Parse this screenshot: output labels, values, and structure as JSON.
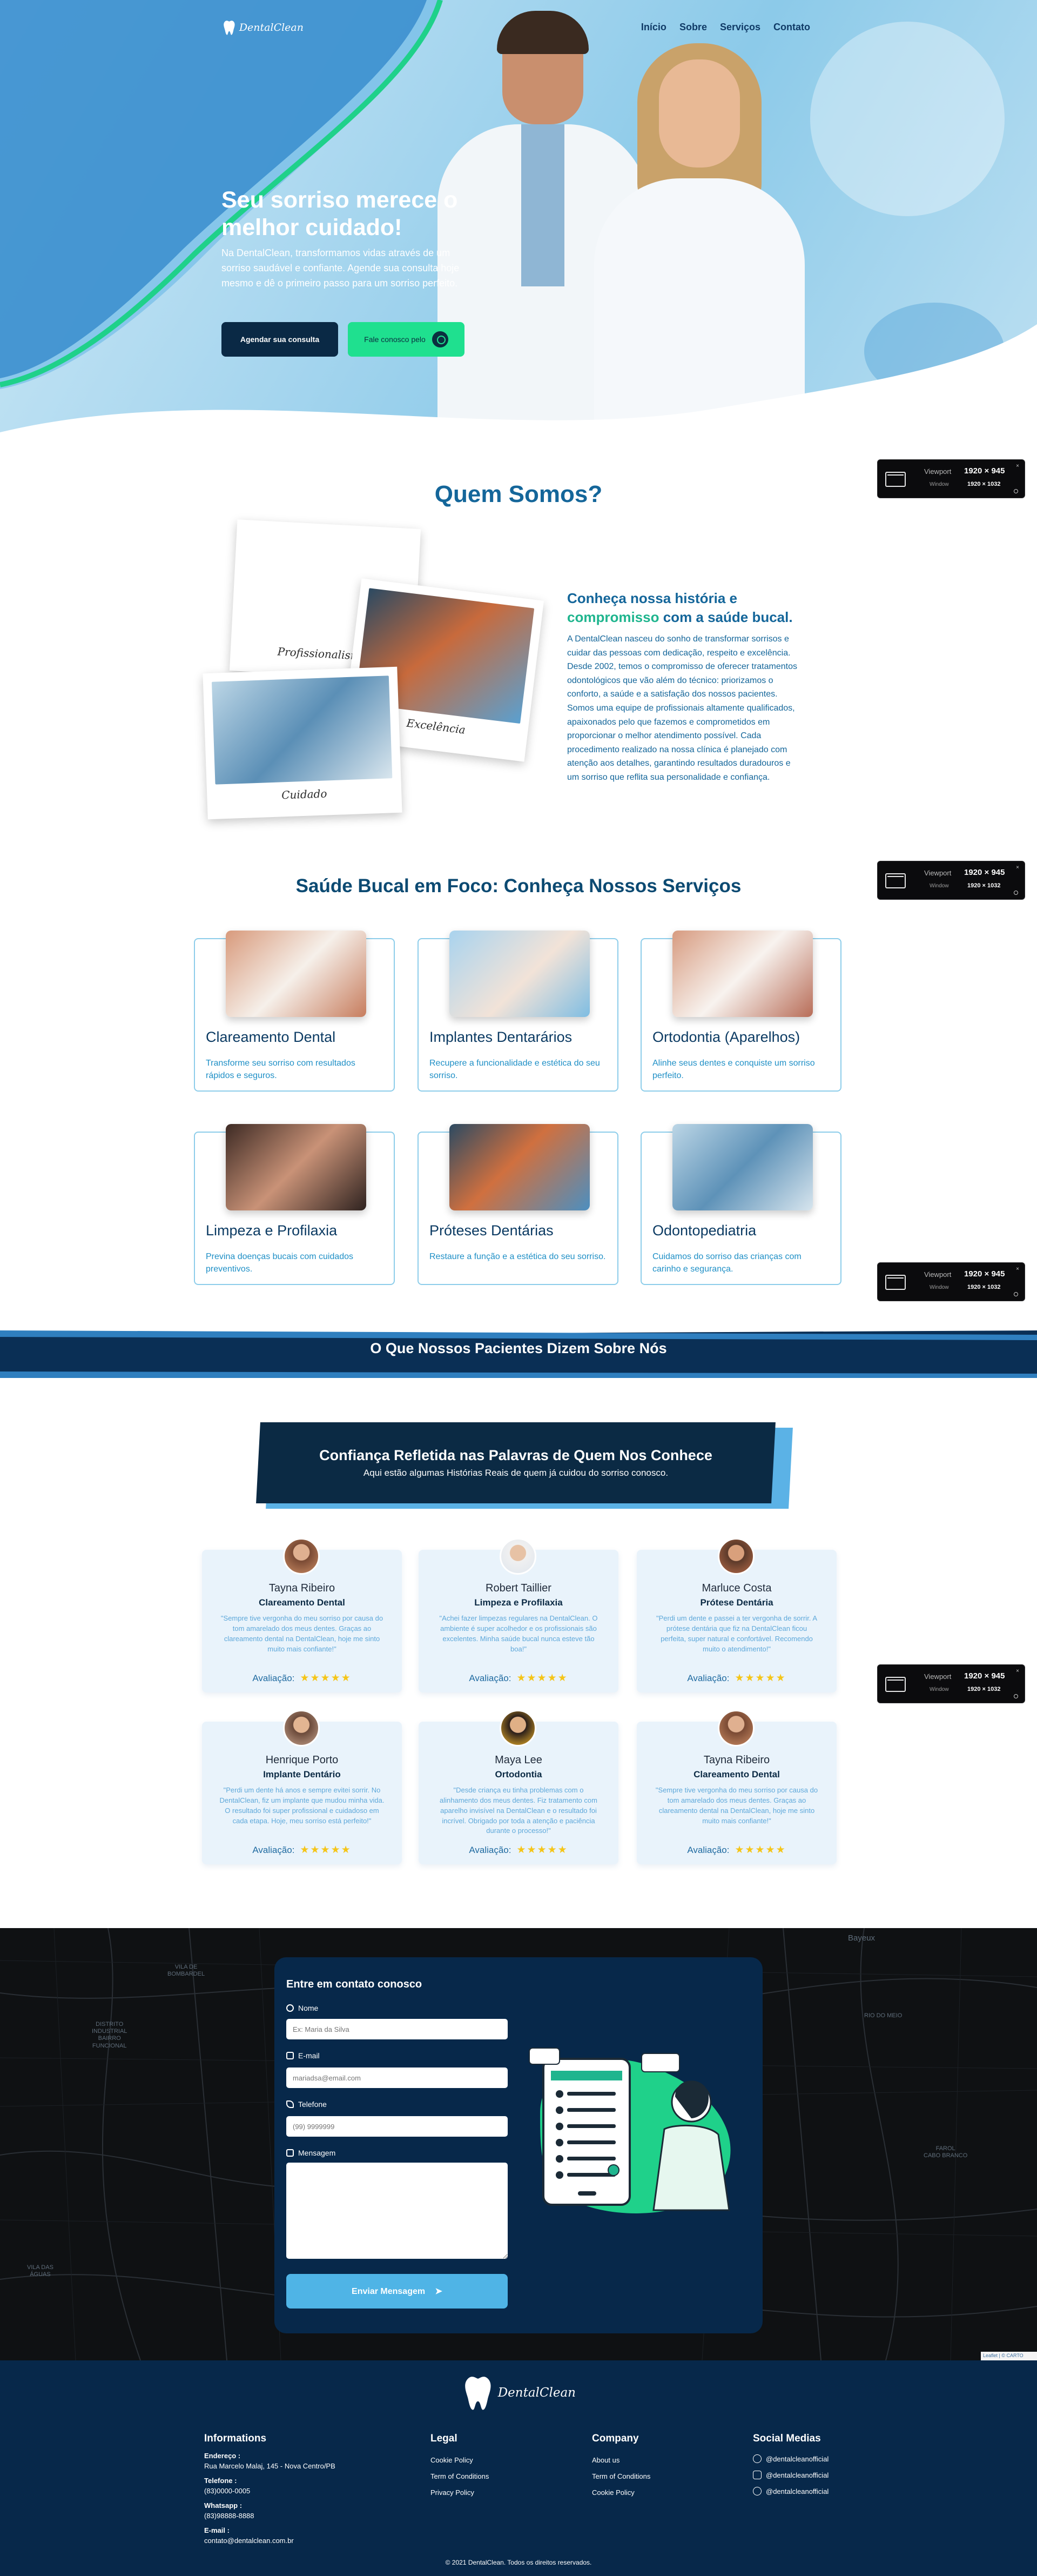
{
  "nav": {
    "logo_text": "DentalClean",
    "links": [
      "Início",
      "Sobre",
      "Serviços",
      "Contato"
    ]
  },
  "hero": {
    "title": "Seu sorriso merece o melhor cuidado!",
    "text": "Na DentalClean, transformamos vidas através de um sorriso saudável e confiante. Agende sua consulta hoje mesmo e dê o primeiro passo para um sorriso perfeito.",
    "button_primary": "Agendar sua consulta",
    "button_whatsapp": "Fale conosco pelo"
  },
  "viewport_badge": {
    "label_viewport": "Viewport",
    "value_viewport": "1920 × 945",
    "label_window": "Window",
    "value_window": "1920 × 1032",
    "close": "×"
  },
  "about": {
    "title": "Quem Somos?",
    "heading_part1": "Conheça nossa história e ",
    "heading_accent": "compromisso",
    "heading_part2": " com a saúde bucal.",
    "text": "A DentalClean nasceu do sonho de transformar sorrisos e cuidar das pessoas com dedicação, respeito e excelência. Desde 2002, temos o compromisso de oferecer tratamentos odontológicos que vão além do técnico: priorizamos o conforto, a saúde e a satisfação dos nossos pacientes. Somos uma equipe de profissionais altamente qualificados, apaixonados pelo que fazemos e comprometidos em proporcionar o melhor atendimento possível. Cada procedimento realizado na nossa clínica é planejado com atenção aos detalhes, garantindo resultados duradouros e um sorriso que reflita sua personalidade e confiança.",
    "photos": [
      {
        "caption": "Profissionalismo"
      },
      {
        "caption": "Excelência"
      },
      {
        "caption": "Cuidado"
      }
    ]
  },
  "services": {
    "title": "Saúde Bucal em Foco: Conheça Nossos Serviços",
    "items": [
      {
        "title": "Clareamento Dental",
        "desc": "Transforme seu sorriso com resultados rápidos e seguros."
      },
      {
        "title": "Implantes Dentarários",
        "desc": "Recupere a funcionalidade e estética do seu sorriso."
      },
      {
        "title": "Ortodontia (Aparelhos)",
        "desc": "Alinhe seus dentes e conquiste um sorriso perfeito."
      },
      {
        "title": "Limpeza e Profilaxia",
        "desc": "Previna doenças bucais com cuidados preventivos."
      },
      {
        "title": "Próteses Dentárias",
        "desc": "Restaure a função e a estética do seu sorriso."
      },
      {
        "title": "Odontopediatria",
        "desc": "Cuidamos do sorriso das crianças com carinho e segurança."
      }
    ]
  },
  "testimonials": {
    "band_title": "O Que Nossos Pacientes Dizem Sobre Nós",
    "box_title": "Confiança Refletida nas Palavras de Quem Nos Conhece",
    "box_subtitle": "Aqui estão algumas Histórias Reais de quem já cuidou do sorriso conosco.",
    "rating_label": "Avaliação:",
    "stars": "★★★★★",
    "items": [
      {
        "name": "Tayna Ribeiro",
        "service": "Clareamento Dental",
        "quote": "\"Sempre tive vergonha do meu sorriso por causa do tom amarelado dos meus dentes. Graças ao clareamento dental na DentalClean, hoje me sinto muito mais confiante!\""
      },
      {
        "name": "Robert Taillier",
        "service": "Limpeza e Profilaxia",
        "quote": "\"Achei fazer limpezas regulares na DentalClean. O ambiente é super acolhedor e os profissionais são excelentes. Minha saúde bucal nunca esteve tão boa!\""
      },
      {
        "name": "Marluce Costa",
        "service": "Prótese Dentária",
        "quote": "\"Perdi um dente e passei a ter vergonha de sorrir. A prótese dentária que fiz na DentalClean ficou perfeita, super natural e confortável. Recomendo muito o atendimento!\""
      },
      {
        "name": "Henrique Porto",
        "service": "Implante Dentário",
        "quote": "\"Perdi um dente há anos e sempre evitei sorrir. No DentalClean, fiz um implante que mudou minha vida. O resultado foi super profissional e cuidadoso em cada etapa. Hoje, meu sorriso está perfeito!\""
      },
      {
        "name": "Maya Lee",
        "service": "Ortodontia",
        "quote": "\"Desde criança eu tinha problemas com o alinhamento dos meus dentes. Fiz tratamento com aparelho invisível na DentalClean e o resultado foi incrível. Obrigado por toda a atenção e paciência durante o processo!\""
      },
      {
        "name": "Tayna Ribeiro",
        "service": "Clareamento Dental",
        "quote": "\"Sempre tive vergonha do meu sorriso por causa do tom amarelado dos meus dentes. Graças ao clareamento dental na DentalClean, hoje me sinto muito mais confiante!\""
      }
    ]
  },
  "contact": {
    "title": "Entre em contato conosco",
    "name_label": "Nome",
    "name_placeholder": "Ex: Maria da Silva",
    "email_label": "E-mail",
    "email_placeholder": "mariadsa@email.com",
    "phone_label": "Telefone",
    "phone_placeholder": "(99) 9999999",
    "message_label": "Mensagem",
    "send_button": "Enviar Mensagem",
    "map_attribution": "Leaflet | © CARTO",
    "map_labels": [
      "Bayeux",
      "VILA DE\nBOMBARDEL",
      "DISTRITO\nINDUSTRIAL\nBAIRRO\nFUNCIONAL",
      "VILA DAS\nÁGUAS",
      "RIO DO MEIO",
      "FAROL\nCABO BRANCO"
    ]
  },
  "footer": {
    "logo_text": "DentalClean",
    "informations": {
      "title": "Informations",
      "address_label": "Endereço :",
      "address": "Rua Marcelo Malaj, 145 - Nova Centro/PB",
      "phone_label": "Telefone :",
      "phone": "(83)0000-0005",
      "whatsapp_label": "Whatsapp :",
      "whatsapp": "(83)98888-8888",
      "email_label": "E-mail :",
      "email": "contato@dentalclean.com.br"
    },
    "legal": {
      "title": "Legal",
      "items": [
        "Cookie Policy",
        "Term of Conditions",
        "Privacy Policy"
      ]
    },
    "company": {
      "title": "Company",
      "items": [
        "About us",
        "Term of Conditions",
        "Cookie Policy"
      ]
    },
    "social": {
      "title": "Social Medias",
      "items": [
        "@dentalcleanofficial",
        "@dentalcleanofficial",
        "@dentalcleanofficial"
      ]
    },
    "copyright": "© 2021 DentalClean. Todos os direitos reservados."
  }
}
